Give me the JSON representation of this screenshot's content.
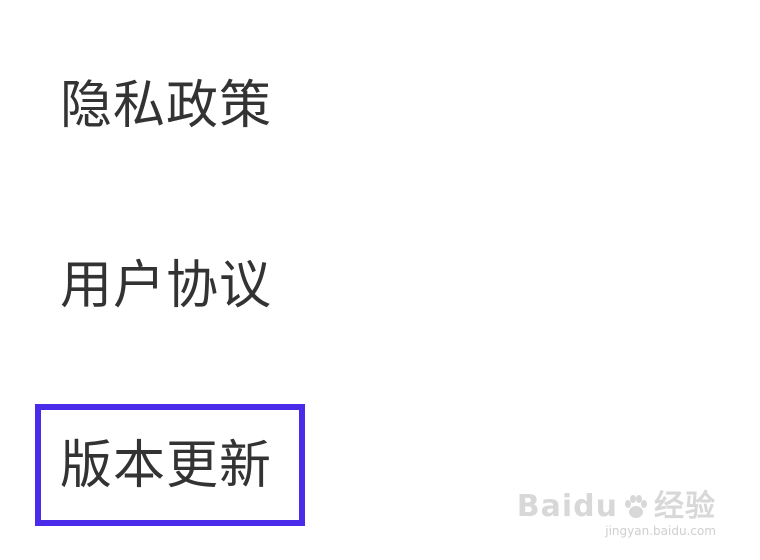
{
  "menu": {
    "items": [
      {
        "label": "隐私政策"
      },
      {
        "label": "用户协议"
      },
      {
        "label": "版本更新"
      }
    ],
    "highlight_color": "#4b2bea"
  },
  "watermark": {
    "brand": "Baidu",
    "suffix": "经验",
    "url": "jingyan.baidu.com",
    "icon": "paw-icon"
  }
}
